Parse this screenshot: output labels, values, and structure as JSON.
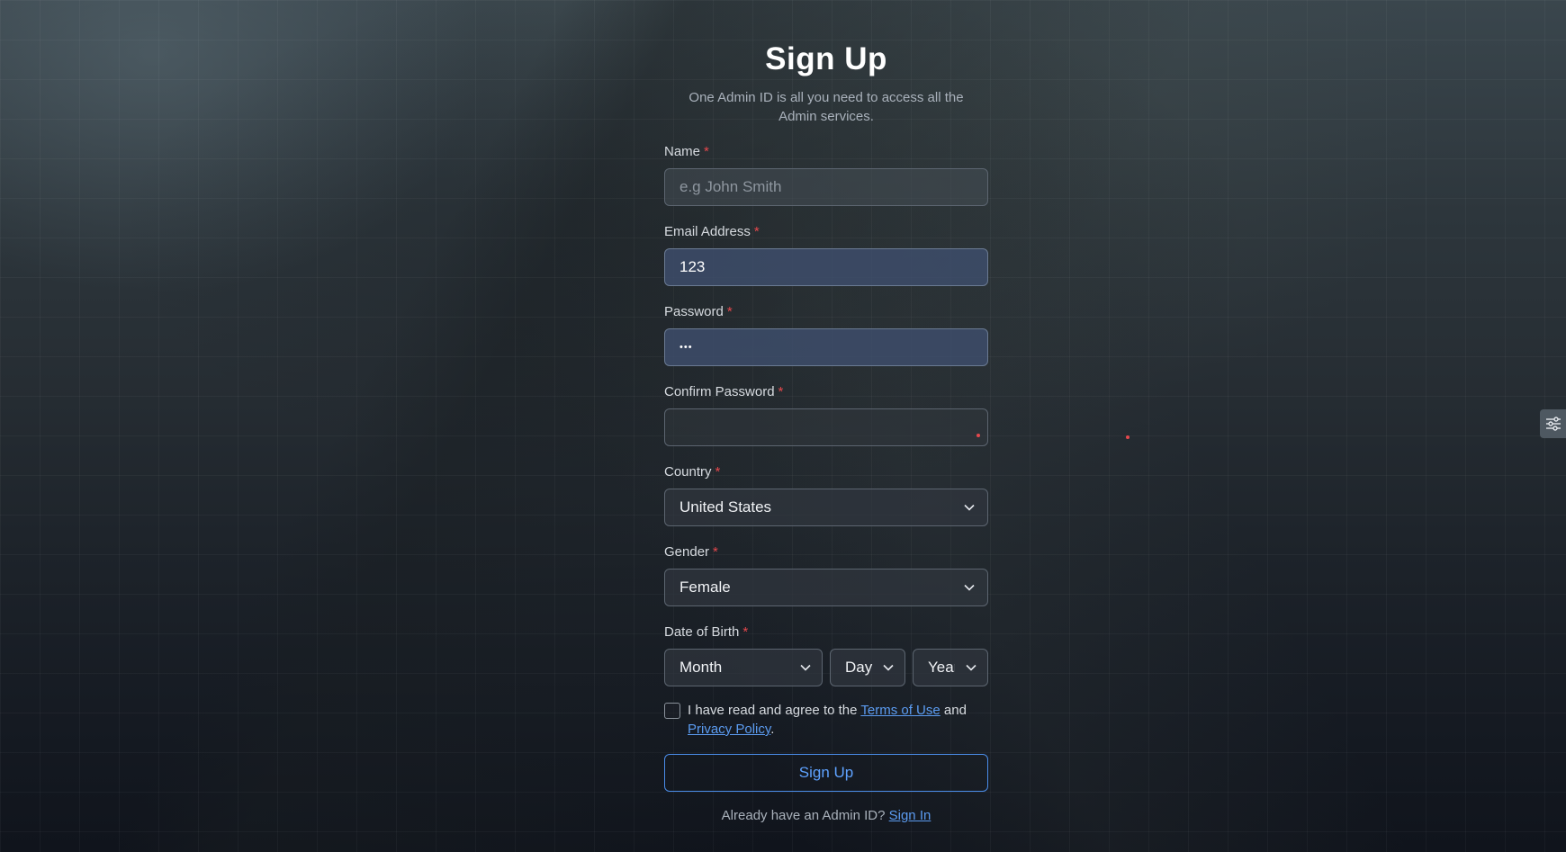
{
  "page": {
    "title": "Sign Up",
    "subtitle": "One Admin ID is all you need to access all the Admin services."
  },
  "form": {
    "name": {
      "label": "Name",
      "required": "*",
      "placeholder": "e.g John Smith",
      "value": ""
    },
    "email": {
      "label": "Email Address",
      "required": "*",
      "value": "123"
    },
    "password": {
      "label": "Password",
      "required": "*",
      "masked_value": "•••"
    },
    "confirm_password": {
      "label": "Confirm Password",
      "required": "*",
      "value": ""
    },
    "country": {
      "label": "Country",
      "required": "*",
      "selected": "United States"
    },
    "gender": {
      "label": "Gender",
      "required": "*",
      "selected": "Female"
    },
    "dob": {
      "label": "Date of Birth",
      "required": "*",
      "month": "Month",
      "day": "Day",
      "year": "Year"
    },
    "agree": {
      "text_before": "I have read and agree to the ",
      "terms_link": "Terms of Use",
      "text_middle": " and ",
      "privacy_link": "Privacy Policy",
      "text_after": "."
    },
    "submit_label": "Sign Up",
    "signin_prompt": "Already have an Admin ID? ",
    "signin_link": "Sign In"
  },
  "colors": {
    "accent": "#5ea2ff",
    "required": "#e5484d"
  },
  "icons": {
    "side_tab": "sliders-icon",
    "select": "chevron-down-icon"
  }
}
